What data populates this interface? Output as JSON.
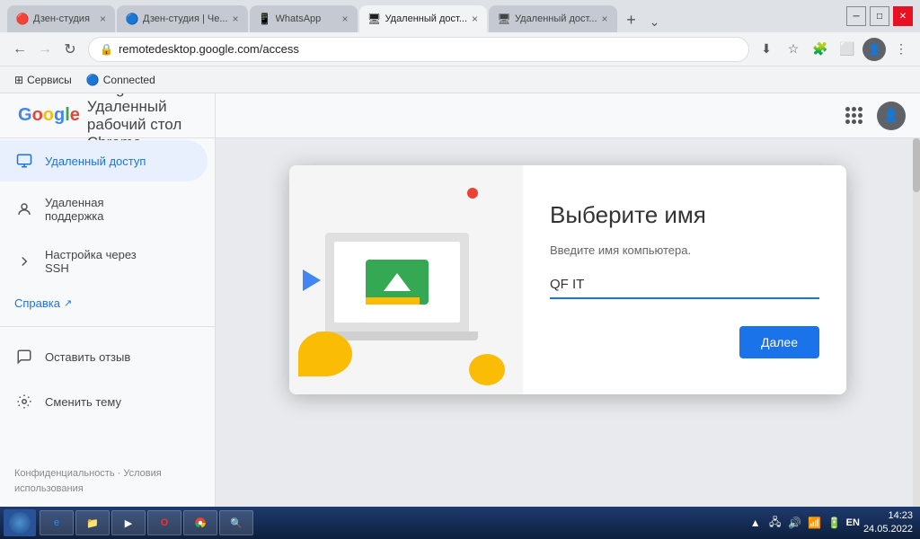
{
  "browser": {
    "tabs": [
      {
        "id": "tab1",
        "label": "Дзен-студия",
        "icon": "🔴",
        "active": false
      },
      {
        "id": "tab2",
        "label": "Дзен-студия | Че...",
        "icon": "🔵",
        "active": false
      },
      {
        "id": "tab3",
        "label": "WhatsApp",
        "icon": "🟢",
        "active": false
      },
      {
        "id": "tab4",
        "label": "Удаленный дост...",
        "icon": "🖥",
        "active": true
      },
      {
        "id": "tab5",
        "label": "Удаленный дост...",
        "icon": "🖥",
        "active": false
      }
    ],
    "address": "remotedesktop.google.com/access",
    "address_full": "remotedesktop.google.com/access"
  },
  "bookmarks": [
    {
      "label": "Сервисы",
      "icon": "⊞"
    },
    {
      "label": "Connected",
      "icon": "🔵"
    }
  ],
  "page": {
    "title": "Google Удаленный рабочий стол Chrome",
    "google_text": "Google"
  },
  "sidebar": {
    "items": [
      {
        "id": "remote-access",
        "label": "Удаленный доступ",
        "icon": "🖥",
        "active": true
      },
      {
        "id": "remote-support",
        "label": "Удаленная поддержка",
        "icon": "👤",
        "active": false
      },
      {
        "id": "ssh",
        "label": "Настройка через SSH",
        "icon": "›",
        "active": false
      }
    ],
    "links": [
      {
        "id": "help",
        "label": "Справка",
        "icon": "↗"
      }
    ],
    "bottom_items": [
      {
        "id": "feedback",
        "label": "Оставить отзыв",
        "icon": "💬"
      },
      {
        "id": "theme",
        "label": "Сменить тему",
        "icon": "⚙"
      }
    ],
    "footer": {
      "privacy": "Конфиденциальность",
      "dot": "·",
      "terms": "Условия использования"
    }
  },
  "dialog": {
    "title": "Выберите имя",
    "subtitle": "Введите имя компьютера.",
    "input_value": "QF IT",
    "input_placeholder": "QF IT",
    "btn_label": "Далее"
  },
  "taskbar": {
    "apps": [
      {
        "label": "Internet Explorer",
        "icon": "🌐"
      },
      {
        "label": "File Explorer",
        "icon": "📁"
      },
      {
        "label": "Media Player",
        "icon": "▶"
      },
      {
        "label": "Opera",
        "icon": "O"
      },
      {
        "label": "Chrome",
        "icon": "⬤"
      },
      {
        "label": "Cortana",
        "icon": "🔍"
      }
    ],
    "tray": {
      "lang": "EN",
      "time": "14:23",
      "date": "24.05.2022"
    }
  }
}
